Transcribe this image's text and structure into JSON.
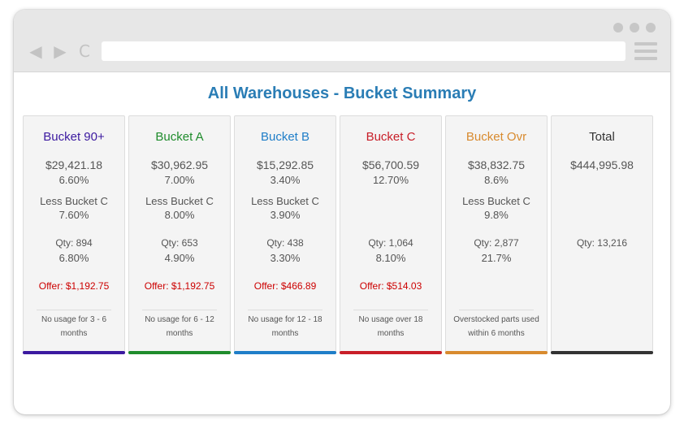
{
  "page": {
    "title": "All Warehouses - Bucket Summary"
  },
  "cards": [
    {
      "name": "Bucket 90+",
      "amount": "$29,421.18",
      "pct": "6.60%",
      "less_label": "Less Bucket C",
      "less_pct": "7.60%",
      "qty": "Qty: 894",
      "qty_pct": "6.80%",
      "offer": "Offer:  $1,192.75",
      "footer": "No usage for 3 - 6 months",
      "color": "#3c1aa0"
    },
    {
      "name": "Bucket A",
      "amount": "$30,962.95",
      "pct": "7.00%",
      "less_label": "Less Bucket C",
      "less_pct": "8.00%",
      "qty": "Qty: 653",
      "qty_pct": "4.90%",
      "offer": "Offer:  $1,192.75",
      "footer": "No usage for 6 - 12 months",
      "color": "#1f8c2c"
    },
    {
      "name": "Bucket B",
      "amount": "$15,292.85",
      "pct": "3.40%",
      "less_label": "Less Bucket C",
      "less_pct": "3.90%",
      "qty": "Qty: 438",
      "qty_pct": "3.30%",
      "offer": "Offer:   $466.89",
      "footer": "No usage for 12 - 18 months",
      "color": "#1f7ec8"
    },
    {
      "name": "Bucket C",
      "amount": "$56,700.59",
      "pct": "12.70%",
      "less_label": "",
      "less_pct": "",
      "qty": "Qty: 1,064",
      "qty_pct": "8.10%",
      "offer": "Offer:   $514.03",
      "footer": "No usage over 18 months",
      "color": "#c81e28"
    },
    {
      "name": "Bucket Ovr",
      "amount": "$38,832.75",
      "pct": "8.6%",
      "less_label": "Less Bucket C",
      "less_pct": "9.8%",
      "qty": "Qty: 2,877",
      "qty_pct": "21.7%",
      "offer": "",
      "footer": "Overstocked parts used within 6 months",
      "color": "#d88a2e"
    },
    {
      "name": "Total",
      "amount": "$444,995.98",
      "pct": "",
      "less_label": "",
      "less_pct": "",
      "qty": "Qty: 13,216",
      "qty_pct": "",
      "offer": "",
      "footer": "",
      "color": "#333333"
    }
  ]
}
